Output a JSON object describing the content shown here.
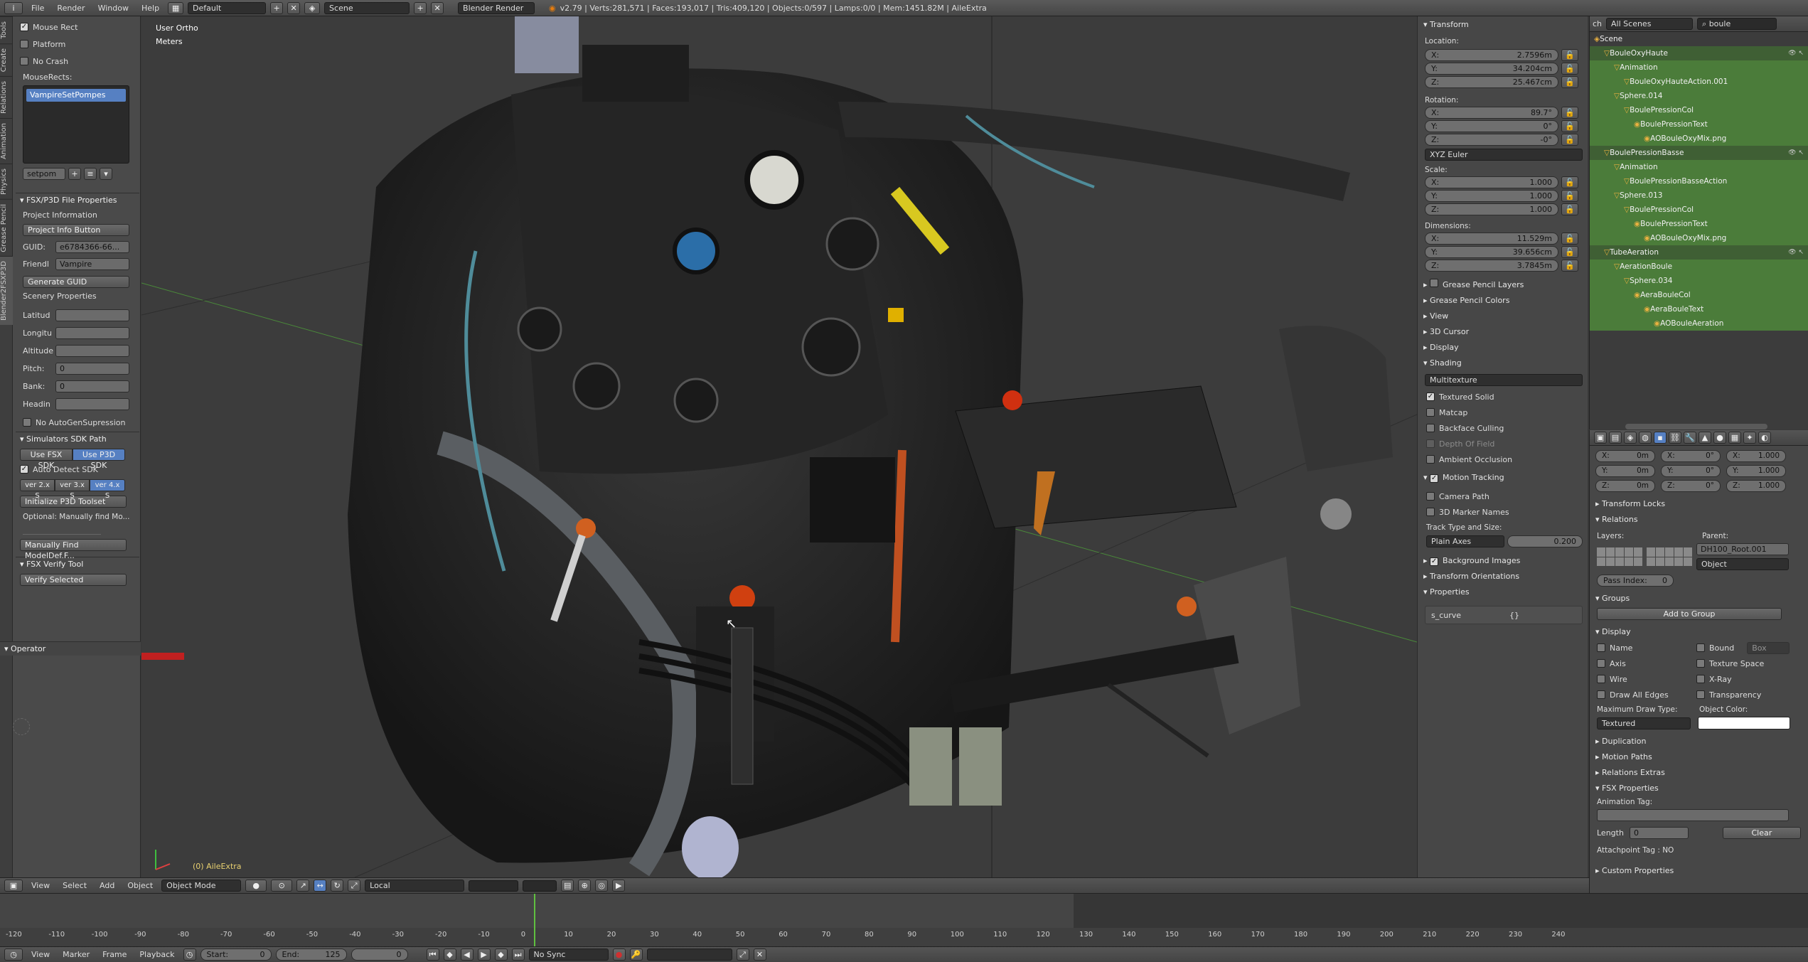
{
  "topbar": {
    "menus": [
      "File",
      "Render",
      "Window",
      "Help"
    ],
    "layout": "Default",
    "scene": "Scene",
    "engine": "Blender Render",
    "stats": "v2.79 | Verts:281,571 | Faces:193,017 | Tris:409,120 | Objects:0/597 | Lamps:0/0 | Mem:1451.82M | AileExtra"
  },
  "toolshelf": {
    "tabs": [
      "Tools",
      "Create",
      "Relations",
      "Animation",
      "Physics",
      "Grease Pencil",
      "Blender2FSXP3D"
    ],
    "mouse_rect": "Mouse Rect",
    "platform": "Platform",
    "no_crash": "No Crash",
    "mouserects_label": "MouseRects:",
    "list_item": "VampireSetPompes",
    "list_field": "setpom",
    "fsx_header": "FSX/P3D File Properties",
    "project_info": "Project Information",
    "project_info_btn": "Project Info Button",
    "guid_label": "GUID:",
    "guid_value": "e6784366-66...",
    "friendly_label": "Friendl",
    "friendly_value": "Vampire",
    "generate_guid": "Generate GUID",
    "scenery_props": "Scenery Properties",
    "latitude_label": "Latitud",
    "longitude_label": "Longitu",
    "altitude_label": "Altitude",
    "pitch_label": "Pitch:",
    "pitch_value": "0",
    "bank_label": "Bank:",
    "bank_value": "0",
    "heading_label": "Headin",
    "no_autogen": "No AutoGenSupression",
    "sdk_header": "Simulators SDK Path",
    "use_fsx": "Use FSX SDK",
    "use_p3d": "Use P3D SDK",
    "auto_detect": "Auto Detect SDK",
    "ver2": "ver 2.x S",
    "ver3": "ver 3.x S",
    "ver4": "ver 4.x S",
    "init_toolset": "Initialize P3D Toolset",
    "optional": "Optional: Manually find Mo...",
    "manual_find": "Manually Find ModelDef.F...",
    "verify_header": "FSX Verify Tool",
    "verify_selected": "Verify Selected",
    "operator": "Operator"
  },
  "viewport": {
    "view_name": "User Ortho",
    "units": "Meters",
    "object_label": "(0) AileExtra"
  },
  "npanel": {
    "transform": "Transform",
    "location_label": "Location:",
    "location": [
      [
        "X:",
        "2.7596m"
      ],
      [
        "Y:",
        "34.204cm"
      ],
      [
        "Z:",
        "25.467cm"
      ]
    ],
    "rotation_label": "Rotation:",
    "rotation": [
      [
        "X:",
        "89.7°"
      ],
      [
        "Y:",
        "0°"
      ],
      [
        "Z:",
        "-0°"
      ]
    ],
    "euler": "XYZ Euler",
    "scale_label": "Scale:",
    "scale": [
      [
        "X:",
        "1.000"
      ],
      [
        "Y:",
        "1.000"
      ],
      [
        "Z:",
        "1.000"
      ]
    ],
    "dimensions_label": "Dimensions:",
    "dimensions": [
      [
        "X:",
        "11.529m"
      ],
      [
        "Y:",
        "39.656cm"
      ],
      [
        "Z:",
        "3.7845m"
      ]
    ],
    "grease_layers": "Grease Pencil Layers",
    "grease_colors": "Grease Pencil Colors",
    "view": "View",
    "cursor": "3D Cursor",
    "display": "Display",
    "shading": "Shading",
    "shading_mode": "Multitexture",
    "textured_solid": "Textured Solid",
    "matcap": "Matcap",
    "backface": "Backface Culling",
    "depth_of_field": "Depth Of Field",
    "ambient_occ": "Ambient Occlusion",
    "motion_tracking": "Motion Tracking",
    "camera_path": "Camera Path",
    "marker_names": "3D Marker Names",
    "track_type": "Track Type and Size:",
    "plain_axes": "Plain Axes",
    "track_size": "0.200",
    "bg_images": "Background Images",
    "transform_orient": "Transform Orientations",
    "properties": "Properties",
    "prop_name": "s_curve",
    "prop_value": "{}"
  },
  "outliner": {
    "filter": "All Scenes",
    "search": "boule",
    "items": [
      "Scene",
      "BouleOxyHaute",
      "Animation",
      "BouleOxyHauteAction.001",
      "Sphere.014",
      "BoulePressionCol",
      "BoulePressionText",
      "AOBouleOxyMix.png",
      "BoulePressionBasse",
      "Animation",
      "BoulePressionBasseAction",
      "Sphere.013",
      "BoulePressionCol",
      "BoulePressionText",
      "AOBouleOxyMix.png",
      "TubeAeration",
      "AerationBoule",
      "Sphere.034",
      "AeraBouleCol",
      "AeraBouleText",
      "AOBouleAeration"
    ]
  },
  "props": {
    "delta": [
      [
        "X:",
        "0m"
      ],
      [
        "Y:",
        "0m"
      ],
      [
        "Z:",
        "0m"
      ],
      [
        "X:",
        "0°"
      ],
      [
        "Y:",
        "0°"
      ],
      [
        "Z:",
        "0°"
      ],
      [
        "X:",
        "1.000"
      ],
      [
        "Y:",
        "1.000"
      ],
      [
        "Z:",
        "1.000"
      ]
    ],
    "transform_locks": "Transform Locks",
    "relations": "Relations",
    "layers_label": "Layers:",
    "parent_label": "Parent:",
    "parent_value": "DH100_Root.001",
    "parent_type": "Object",
    "pass_index": "Pass Index:",
    "pass_value": "0",
    "groups": "Groups",
    "add_group": "Add to Group",
    "display": "Display",
    "name": "Name",
    "bound": "Bound",
    "bound_type": "Box",
    "axis": "Axis",
    "texture_space": "Texture Space",
    "wire": "Wire",
    "xray": "X-Ray",
    "draw_edges": "Draw All Edges",
    "transparency": "Transparency",
    "max_draw": "Maximum Draw Type:",
    "obj_color": "Object Color:",
    "draw_type": "Textured",
    "duplication": "Duplication",
    "motion_paths": "Motion Paths",
    "relations_extras": "Relations Extras",
    "fsx_properties": "FSX Properties",
    "anim_tag": "Animation Tag:",
    "length_label": "Length",
    "length_value": "0",
    "clear": "Clear",
    "attachpoint": "Attachpoint Tag : NO",
    "custom_props": "Custom Properties"
  },
  "vheader": {
    "menus": [
      "View",
      "Select",
      "Add",
      "Object"
    ],
    "mode": "Object Mode",
    "orientation": "Local"
  },
  "timeline": {
    "ticks": [
      "-120",
      "-110",
      "-100",
      "-90",
      "-80",
      "-70",
      "-60",
      "-50",
      "-40",
      "-30",
      "-20",
      "-10",
      "0",
      "10",
      "20",
      "30",
      "40",
      "50",
      "60",
      "70",
      "80",
      "90",
      "100",
      "110",
      "120",
      "130",
      "140",
      "150",
      "160",
      "170",
      "180",
      "190",
      "200",
      "210",
      "220",
      "230",
      "240"
    ],
    "menus": [
      "View",
      "Marker",
      "Frame",
      "Playback"
    ],
    "start": "Start:",
    "start_val": "0",
    "end": "End:",
    "end_val": "125",
    "current": "0",
    "sync": "No Sync"
  },
  "colors": {
    "accent_blue": "#5680c2",
    "selected_green": "#4b7c3a",
    "frame_line": "#60c040"
  }
}
